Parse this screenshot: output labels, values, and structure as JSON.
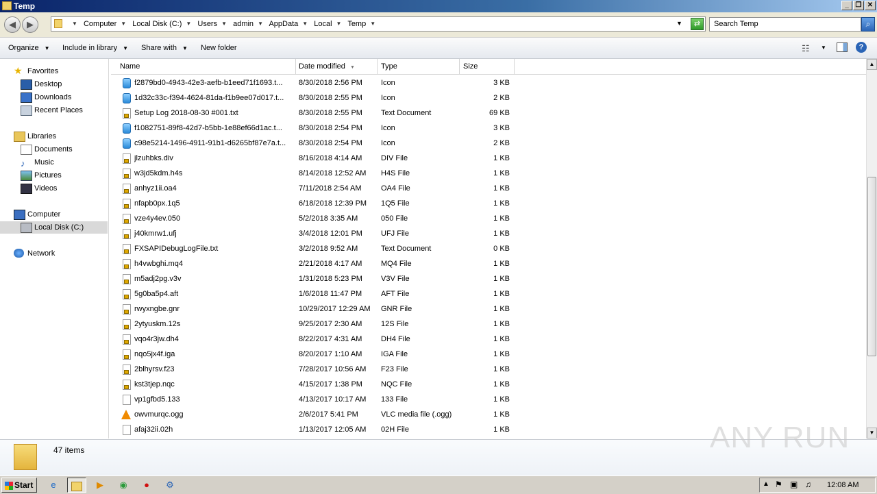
{
  "window": {
    "title": "Temp"
  },
  "address": {
    "crumbs": [
      "Computer",
      "Local Disk (C:)",
      "Users",
      "admin",
      "AppData",
      "Local",
      "Temp"
    ],
    "search_placeholder": "Search Temp"
  },
  "toolbar": {
    "organize": "Organize",
    "include_in_library": "Include in library",
    "share_with": "Share with",
    "new_folder": "New folder"
  },
  "nav": {
    "favorites": "Favorites",
    "desktop": "Desktop",
    "downloads": "Downloads",
    "recent_places": "Recent Places",
    "libraries": "Libraries",
    "documents": "Documents",
    "music": "Music",
    "pictures": "Pictures",
    "videos": "Videos",
    "computer": "Computer",
    "local_disk": "Local Disk (C:)",
    "network": "Network"
  },
  "columns": {
    "name": "Name",
    "date": "Date modified",
    "type": "Type",
    "size": "Size"
  },
  "files": [
    {
      "name": "f2879bd0-4943-42e3-aefb-b1eed71f1693.t...",
      "date": "8/30/2018 2:56 PM",
      "type": "Icon",
      "size": "3 KB",
      "icon": "icon-file-icon"
    },
    {
      "name": "1d32c33c-f394-4624-81da-f1b9ee07d017.t...",
      "date": "8/30/2018 2:55 PM",
      "type": "Icon",
      "size": "2 KB",
      "icon": "icon-file-icon"
    },
    {
      "name": "Setup Log 2018-08-30 #001.txt",
      "date": "8/30/2018 2:55 PM",
      "type": "Text Document",
      "size": "69 KB",
      "icon": "text-file-icon"
    },
    {
      "name": "f1082751-89f8-42d7-b5bb-1e88ef66d1ac.t...",
      "date": "8/30/2018 2:54 PM",
      "type": "Icon",
      "size": "3 KB",
      "icon": "icon-file-icon"
    },
    {
      "name": "c98e5214-1496-4911-91b1-d6265bf87e7a.t...",
      "date": "8/30/2018 2:54 PM",
      "type": "Icon",
      "size": "2 KB",
      "icon": "icon-file-icon"
    },
    {
      "name": "jlzuhbks.div",
      "date": "8/16/2018 4:14 AM",
      "type": "DIV File",
      "size": "1 KB",
      "icon": "locked-file-icon"
    },
    {
      "name": "w3jd5kdm.h4s",
      "date": "8/14/2018 12:52 AM",
      "type": "H4S File",
      "size": "1 KB",
      "icon": "locked-file-icon"
    },
    {
      "name": "anhyz1ii.oa4",
      "date": "7/11/2018 2:54 AM",
      "type": "OA4 File",
      "size": "1 KB",
      "icon": "locked-file-icon"
    },
    {
      "name": "nfapb0px.1q5",
      "date": "6/18/2018 12:39 PM",
      "type": "1Q5 File",
      "size": "1 KB",
      "icon": "locked-file-icon"
    },
    {
      "name": "vze4y4ev.050",
      "date": "5/2/2018 3:35 AM",
      "type": "050 File",
      "size": "1 KB",
      "icon": "locked-file-icon"
    },
    {
      "name": "j40kmrw1.ufj",
      "date": "3/4/2018 12:01 PM",
      "type": "UFJ File",
      "size": "1 KB",
      "icon": "locked-file-icon"
    },
    {
      "name": "FXSAPIDebugLogFile.txt",
      "date": "3/2/2018 9:52 AM",
      "type": "Text Document",
      "size": "0 KB",
      "icon": "locked-file-icon"
    },
    {
      "name": "h4vwbghi.mq4",
      "date": "2/21/2018 4:17 AM",
      "type": "MQ4 File",
      "size": "1 KB",
      "icon": "locked-file-icon"
    },
    {
      "name": "m5adj2pg.v3v",
      "date": "1/31/2018 5:23 PM",
      "type": "V3V File",
      "size": "1 KB",
      "icon": "locked-file-icon"
    },
    {
      "name": "5g0ba5p4.aft",
      "date": "1/6/2018 11:47 PM",
      "type": "AFT File",
      "size": "1 KB",
      "icon": "locked-file-icon"
    },
    {
      "name": "rwyxngbe.gnr",
      "date": "10/29/2017 12:29 AM",
      "type": "GNR File",
      "size": "1 KB",
      "icon": "locked-file-icon"
    },
    {
      "name": "2ytyuskm.12s",
      "date": "9/25/2017 2:30 AM",
      "type": "12S File",
      "size": "1 KB",
      "icon": "locked-file-icon"
    },
    {
      "name": "vqo4r3jw.dh4",
      "date": "8/22/2017 4:31 AM",
      "type": "DH4 File",
      "size": "1 KB",
      "icon": "locked-file-icon"
    },
    {
      "name": "nqo5jx4f.iga",
      "date": "8/20/2017 1:10 AM",
      "type": "IGA File",
      "size": "1 KB",
      "icon": "locked-file-icon"
    },
    {
      "name": "2blhyrsv.f23",
      "date": "7/28/2017 10:56 AM",
      "type": "F23 File",
      "size": "1 KB",
      "icon": "locked-file-icon"
    },
    {
      "name": "kst3tjep.nqc",
      "date": "4/15/2017 1:38 PM",
      "type": "NQC File",
      "size": "1 KB",
      "icon": "locked-file-icon"
    },
    {
      "name": "vp1gfbd5.133",
      "date": "4/13/2017 10:17 AM",
      "type": "133 File",
      "size": "1 KB",
      "icon": "blank-file-icon"
    },
    {
      "name": "owvmurqc.ogg",
      "date": "2/6/2017 5:41 PM",
      "type": "VLC media file (.ogg)",
      "size": "1 KB",
      "icon": "vlc-icon"
    },
    {
      "name": "afaj32ii.02h",
      "date": "1/13/2017 12:05 AM",
      "type": "02H File",
      "size": "1 KB",
      "icon": "blank-file-icon"
    }
  ],
  "details": {
    "item_count": "47 items"
  },
  "watermark": "ANY RUN",
  "taskbar": {
    "start": "Start",
    "clock": "12:08 AM"
  }
}
